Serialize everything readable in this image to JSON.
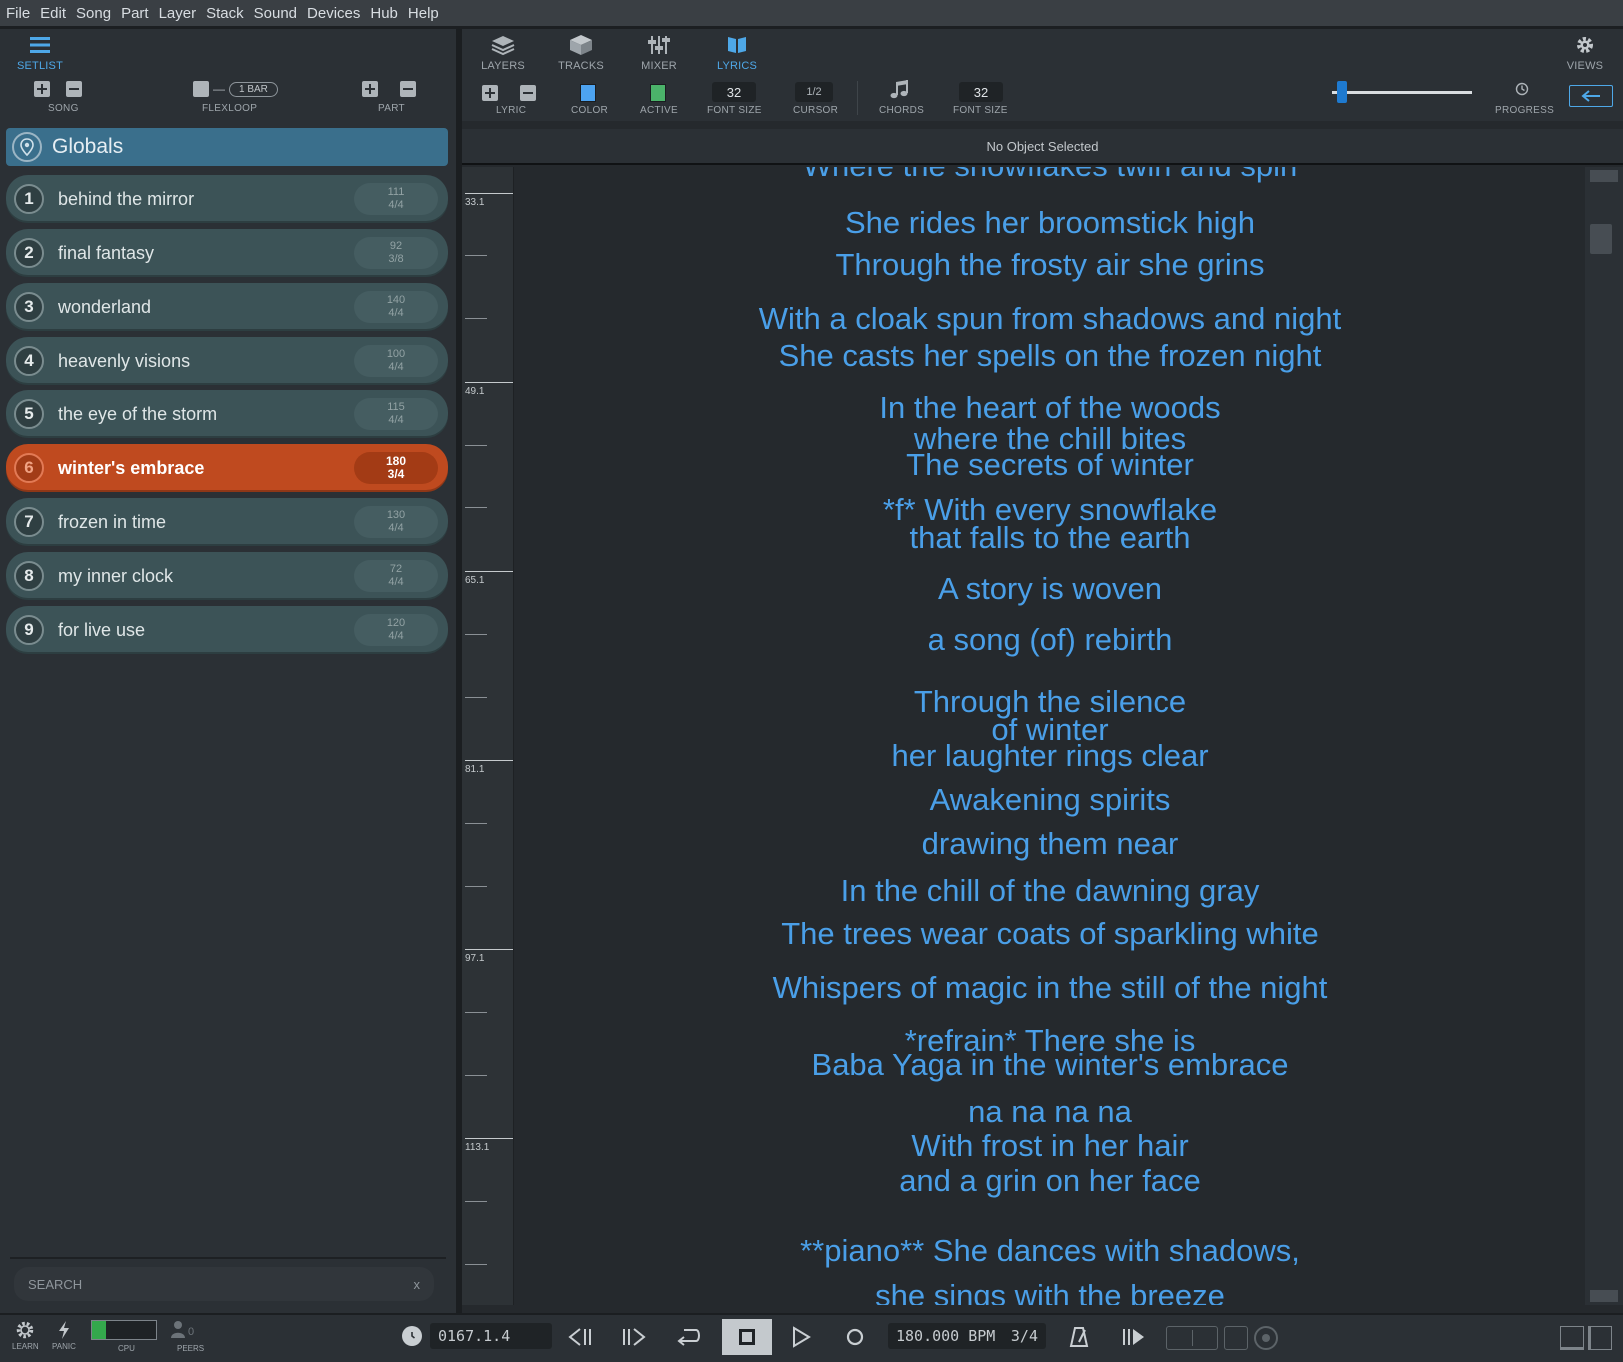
{
  "menu": [
    "File",
    "Edit",
    "Song",
    "Part",
    "Layer",
    "Stack",
    "Sound",
    "Devices",
    "Hub",
    "Help"
  ],
  "left_toolbar": {
    "setlist_label": "SETLIST",
    "song_label": "SONG",
    "flexloop_label": "FLEXLOOP",
    "flexloop_value": "1 BAR",
    "part_label": "PART"
  },
  "globals_label": "Globals",
  "songs": [
    {
      "num": "1",
      "title": "behind the mirror",
      "tempo": "111",
      "sig": "4/4"
    },
    {
      "num": "2",
      "title": "final fantasy",
      "tempo": "92",
      "sig": "3/8"
    },
    {
      "num": "3",
      "title": "wonderland",
      "tempo": "140",
      "sig": "4/4"
    },
    {
      "num": "4",
      "title": "heavenly visions",
      "tempo": "100",
      "sig": "4/4"
    },
    {
      "num": "5",
      "title": "the eye of the storm",
      "tempo": "115",
      "sig": "4/4"
    },
    {
      "num": "6",
      "title": "winter's embrace",
      "tempo": "180",
      "sig": "3/4"
    },
    {
      "num": "7",
      "title": "frozen in time",
      "tempo": "130",
      "sig": "4/4"
    },
    {
      "num": "8",
      "title": "my inner clock",
      "tempo": "72",
      "sig": "4/4"
    },
    {
      "num": "9",
      "title": "for live use",
      "tempo": "120",
      "sig": "4/4"
    }
  ],
  "search": {
    "placeholder": "SEARCH",
    "clear": "x"
  },
  "view_tabs": {
    "layers": "LAYERS",
    "tracks": "TRACKS",
    "mixer": "MIXER",
    "lyrics": "LYRICS",
    "views": "VIEWS"
  },
  "lyric_toolbar": {
    "lyric_label": "LYRIC",
    "color_label": "COLOR",
    "active_label": "ACTIVE",
    "font_size_value": "32",
    "font_size_label": "FONT SIZE",
    "cursor_value": "1/2",
    "cursor_label": "CURSOR",
    "chords_label": "CHORDS",
    "chords_font_size_value": "32",
    "chords_font_size_label": "FONT SIZE",
    "progress_label": "PROGRESS",
    "color_swatch": "#4da3f0",
    "active_swatch": "#4bb36a"
  },
  "status": "No Object Selected",
  "ruler_labels": [
    "33.1",
    "49.1",
    "65.1",
    "81.1",
    "97.1",
    "113.1"
  ],
  "lyrics": [
    "Where the snowflakes twirl and spin",
    "She rides her broomstick high",
    "Through the frosty air she grins",
    "With a cloak spun from shadows and night",
    "She casts her spells on the frozen night",
    "In the heart of the woods",
    "where the chill bites",
    "The secrets of winter",
    "*f* With every snowflake",
    "that falls to the earth",
    "A story is woven",
    "a song (of) rebirth",
    "Through the silence",
    "of winter",
    "her laughter rings clear",
    "Awakening spirits",
    "drawing them near",
    "In the chill of the dawning gray",
    "The trees wear coats of sparkling white",
    "Whispers of magic in the still of the night",
    "*refrain* There she is",
    "Baba Yaga in the winter's embrace",
    "na na na na",
    "With frost in her hair",
    "and a grin on her face",
    "**piano** She dances with shadows,",
    "she sings with the breeze"
  ],
  "bottom": {
    "learn": "LEARN",
    "panic": "PANIC",
    "cpu": "CPU",
    "peers": "PEERS",
    "peers_count": "0",
    "position": "0167.1.4",
    "bpm": "180.000 BPM",
    "sig": "3/4"
  },
  "colors": {
    "accent": "#4a9fe8",
    "active_song": "#bf4a1f",
    "globals": "#3a6f8c",
    "song_row": "#3c5357"
  }
}
